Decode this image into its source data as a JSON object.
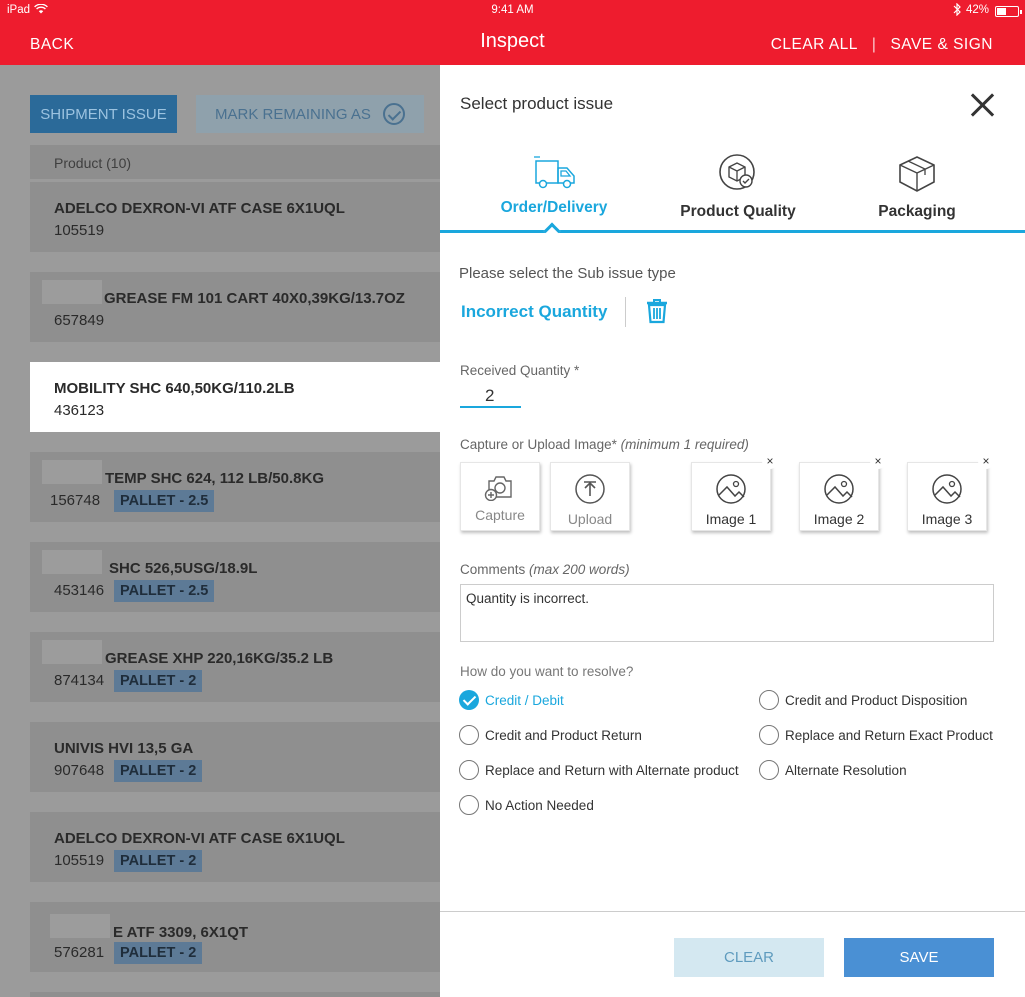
{
  "status_bar": {
    "device": "iPad",
    "time": "9:41 AM",
    "battery": "42%"
  },
  "nav": {
    "back": "BACK",
    "title": "Inspect",
    "clear_all": "CLEAR ALL",
    "separator": "|",
    "save_sign": "SAVE & SIGN"
  },
  "left": {
    "shipment_issue": "SHIPMENT ISSUE",
    "mark_remaining": "MARK REMAINING AS",
    "list_header": "Product (10)",
    "items": [
      {
        "name": "ADELCO DEXRON-VI ATF CASE 6X1UQL",
        "code": "105519",
        "pallet": ""
      },
      {
        "name": "GREASE FM 101 CART 40X0,39KG/13.7OZ",
        "code": "657849",
        "pallet": ""
      },
      {
        "name": "MOBILITY SHC 640,50KG/110.2LB",
        "code": "436123",
        "pallet": ""
      },
      {
        "name": "TEMP SHC 624, 112 LB/50.8KG",
        "code": "156748",
        "pallet": "PALLET - 2.5"
      },
      {
        "name": "SHC 526,5USG/18.9L",
        "code": "453146",
        "pallet": "PALLET - 2.5"
      },
      {
        "name": "GREASE XHP 220,16KG/35.2 LB",
        "code": "874134",
        "pallet": "PALLET - 2"
      },
      {
        "name": "UNIVIS HVI 13,5 GA",
        "code": "907648",
        "pallet": "PALLET - 2"
      },
      {
        "name": "ADELCO DEXRON-VI ATF CASE 6X1UQL",
        "code": "105519",
        "pallet": "PALLET - 2"
      },
      {
        "name": "E ATF 3309, 6X1QT",
        "code": "576281",
        "pallet": "PALLET - 2"
      }
    ]
  },
  "panel": {
    "title": "Select product issue",
    "tabs": [
      {
        "label": "Order/Delivery",
        "icon": "truck-icon",
        "active": true
      },
      {
        "label": "Product Quality",
        "icon": "quality-badge-icon",
        "active": false
      },
      {
        "label": "Packaging",
        "icon": "box-icon",
        "active": false
      }
    ],
    "sub_issue_label": "Please select the Sub issue type",
    "sub_issue_value": "Incorrect Quantity",
    "received_qty_label": "Received Quantity *",
    "received_qty_value": "2",
    "capture_label": "Capture or Upload Image*",
    "capture_hint": "(minimum 1 required)",
    "capture": "Capture",
    "upload": "Upload",
    "images": [
      "Image 1",
      "Image 2",
      "Image 3"
    ],
    "remove_glyph": "×",
    "comments_label": "Comments",
    "comments_hint": "(max 200 words)",
    "comments_value": "Quantity is incorrect.",
    "resolve_label": "How do you want to resolve?",
    "resolutions": [
      "Credit / Debit",
      "Credit and Product Disposition",
      "Credit and Product Return",
      "Replace and Return Exact Product",
      "Replace and Return with Alternate product",
      "Alternate Resolution",
      "No Action Needed"
    ],
    "selected_resolution": "Credit / Debit",
    "clear": "CLEAR",
    "save": "SAVE"
  },
  "colors": {
    "brand_red": "#ee1c2e",
    "accent_blue": "#1aa7dd",
    "save_blue": "#4a90d4"
  }
}
